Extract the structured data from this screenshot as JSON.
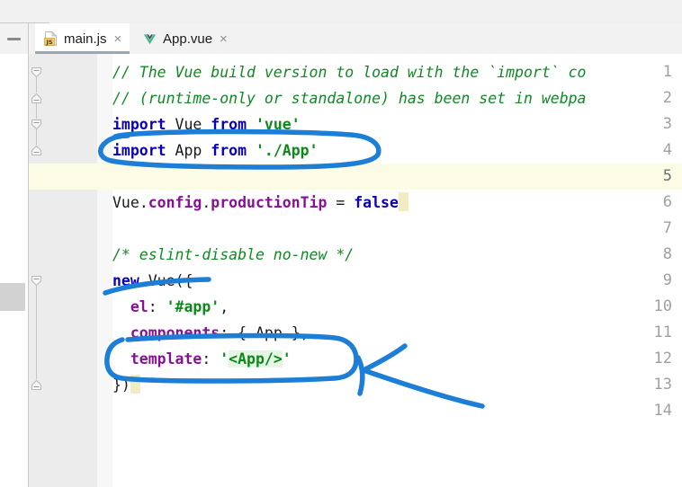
{
  "window": {
    "minimize_tooltip": "Hide",
    "tool_stripe_label": ""
  },
  "tabs": [
    {
      "label": "main.js",
      "icon": "javascript-file-icon",
      "close": "×",
      "active": true
    },
    {
      "label": "App.vue",
      "icon": "vue-file-icon",
      "close": "×",
      "active": false
    }
  ],
  "editor": {
    "current_line": 5,
    "line_numbers": [
      "1",
      "2",
      "3",
      "4",
      "5",
      "6",
      "7",
      "8",
      "9",
      "10",
      "11",
      "12",
      "13",
      "14"
    ],
    "lines": [
      {
        "n": "1",
        "tokens": [
          {
            "t": "// The Vue build version to load with the `import` co",
            "c": "cmt"
          }
        ]
      },
      {
        "n": "2",
        "tokens": [
          {
            "t": "// (runtime-only or standalone) has been set in webpa",
            "c": "cmt"
          }
        ]
      },
      {
        "n": "3",
        "tokens": [
          {
            "t": "import",
            "c": "kw"
          },
          {
            "t": " Vue ",
            "c": "plain"
          },
          {
            "t": "from",
            "c": "kw"
          },
          {
            "t": " ",
            "c": "plain"
          },
          {
            "t": "'vue'",
            "c": "str"
          }
        ]
      },
      {
        "n": "4",
        "tokens": [
          {
            "t": "import",
            "c": "kw"
          },
          {
            "t": " App ",
            "c": "plain"
          },
          {
            "t": "from",
            "c": "kw"
          },
          {
            "t": " ",
            "c": "plain"
          },
          {
            "t": "'./App'",
            "c": "str"
          }
        ]
      },
      {
        "n": "5",
        "tokens": [
          {
            "t": "",
            "c": "plain"
          }
        ]
      },
      {
        "n": "6",
        "tokens": [
          {
            "t": "Vue",
            "c": "plain"
          },
          {
            "t": ".",
            "c": "plain"
          },
          {
            "t": "config",
            "c": "prop"
          },
          {
            "t": ".",
            "c": "plain"
          },
          {
            "t": "productionTip",
            "c": "prop"
          },
          {
            "t": " = ",
            "c": "plain"
          },
          {
            "t": "false",
            "c": "kw"
          },
          {
            "t": "█",
            "c": "caret"
          }
        ]
      },
      {
        "n": "7",
        "tokens": [
          {
            "t": "",
            "c": "plain"
          }
        ]
      },
      {
        "n": "8",
        "tokens": [
          {
            "t": "/* eslint-disable no-new */",
            "c": "cmt"
          }
        ]
      },
      {
        "n": "9",
        "tokens": [
          {
            "t": "new",
            "c": "kw"
          },
          {
            "t": " Vue({",
            "c": "plain"
          }
        ]
      },
      {
        "n": "10",
        "tokens": [
          {
            "t": "  ",
            "c": "plain"
          },
          {
            "t": "el",
            "c": "prop"
          },
          {
            "t": ": ",
            "c": "plain"
          },
          {
            "t": "'#app'",
            "c": "str"
          },
          {
            "t": ",",
            "c": "plain"
          }
        ]
      },
      {
        "n": "11",
        "tokens": [
          {
            "t": "  ",
            "c": "plain"
          },
          {
            "t": "components",
            "c": "prop"
          },
          {
            "t": ": { App },",
            "c": "plain"
          }
        ]
      },
      {
        "n": "12",
        "tokens": [
          {
            "t": "  ",
            "c": "plain"
          },
          {
            "t": "template",
            "c": "prop"
          },
          {
            "t": ": ",
            "c": "plain"
          },
          {
            "t": "'",
            "c": "str"
          },
          {
            "t": "<App/>",
            "c": "str tplhl"
          },
          {
            "t": "'",
            "c": "str"
          }
        ]
      },
      {
        "n": "13",
        "tokens": [
          {
            "t": "})",
            "c": "plain"
          },
          {
            "t": "█",
            "c": "caret"
          }
        ]
      },
      {
        "n": "14",
        "tokens": [
          {
            "t": "",
            "c": "plain"
          }
        ]
      }
    ]
  },
  "annotations": {
    "color": "#1c7ed6",
    "marks": [
      {
        "name": "circle-import-app-line",
        "shape": "ellipse",
        "target_line": 4
      },
      {
        "name": "underline-new-vue-line",
        "shape": "underline",
        "target_line": 9
      },
      {
        "name": "circle-template-line",
        "shape": "rounded-rect",
        "target_line": 12
      },
      {
        "name": "pointer-arrow-to-template",
        "shape": "arrow",
        "target_line": 12
      }
    ]
  },
  "colors": {
    "keyword": "#0a00b7",
    "comment": "#0f8a23",
    "string": "#0a8a17",
    "property": "#871094",
    "annotation": "#1c7ed6",
    "current_line_bg": "#fcfbe5",
    "gutter_bg": "#ececec",
    "tab_bar_bg": "#f2f2f2",
    "template_highlight": "#e7f5e4"
  }
}
